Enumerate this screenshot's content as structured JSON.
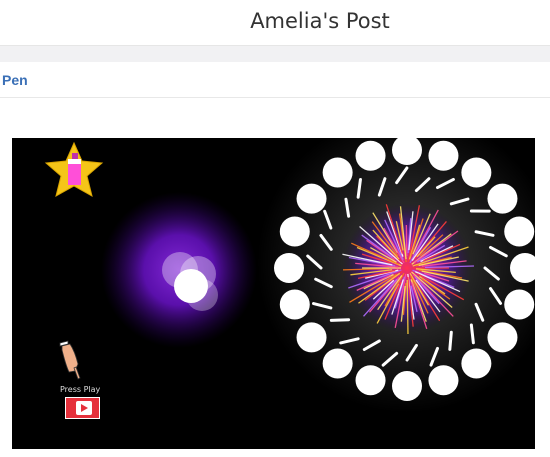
{
  "header": {
    "title": "Amelia's Post"
  },
  "tabs": [
    {
      "label": "Pen"
    }
  ],
  "stage": {
    "press_play_label": "Press Play",
    "icons": {
      "star": "star-sprite-icon",
      "pointer": "pointing-hand-icon",
      "play": "play-icon"
    },
    "colors": {
      "background": "#000000",
      "glow": "#7a17d6",
      "star": "#f5c518",
      "play": "#e5303b"
    }
  }
}
